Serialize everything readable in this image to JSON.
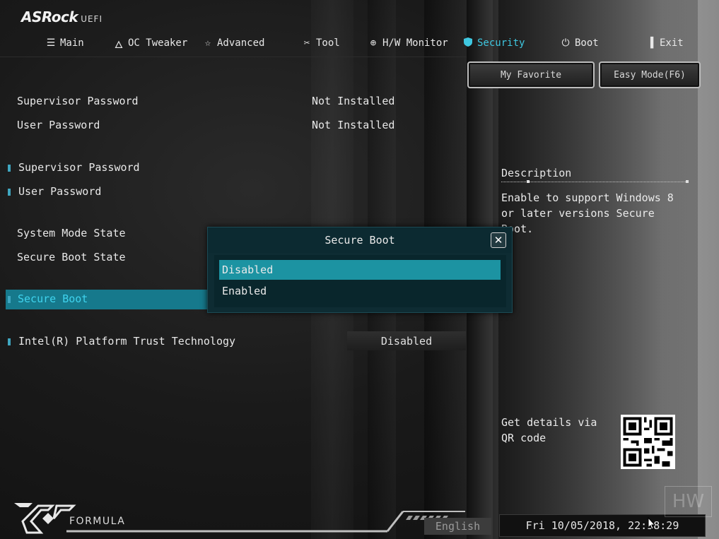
{
  "header": {
    "brand": "ASRock",
    "uefi": "UEFI",
    "tabs": [
      {
        "label": "Main",
        "icon": "list-icon"
      },
      {
        "label": "OC Tweaker",
        "icon": "flame-icon"
      },
      {
        "label": "Advanced",
        "icon": "star-icon"
      },
      {
        "label": "Tool",
        "icon": "tools-icon"
      },
      {
        "label": "H/W Monitor",
        "icon": "crosshair-icon"
      },
      {
        "label": "Security",
        "icon": "shield-icon",
        "active": true
      },
      {
        "label": "Boot",
        "icon": "power-icon"
      },
      {
        "label": "Exit",
        "icon": "exit-door-icon"
      }
    ]
  },
  "buttons": {
    "favorite": "My Favorite",
    "easy_mode": "Easy Mode(F6)"
  },
  "settings": {
    "supervisor_password_label": "Supervisor Password",
    "supervisor_password_value": "Not Installed",
    "user_password_label": "User Password",
    "user_password_value": "Not Installed",
    "set_supervisor_password": "Supervisor Password",
    "set_user_password": "User Password",
    "system_mode_state": "System Mode State",
    "secure_boot_state": "Secure Boot State",
    "secure_boot": "Secure Boot",
    "ptt_label": "Intel(R) Platform Trust Technology",
    "ptt_value": "Disabled"
  },
  "description": {
    "title": "Description",
    "text": "Enable to support Windows 8 or later versions Secure Boot.",
    "qr_text": "Get details via QR code"
  },
  "modal": {
    "title": "Secure Boot",
    "close": "✕",
    "options": [
      "Disabled",
      "Enabled"
    ],
    "selected": "Disabled"
  },
  "footer": {
    "formula": "FORMULA",
    "language": "English",
    "datetime": "Fri 10/05/2018, 22:38:29",
    "watermark": "HW"
  },
  "colors": {
    "accent": "#3fc7e0",
    "selection": "#16798c",
    "modal_selection": "#1c93a2"
  }
}
